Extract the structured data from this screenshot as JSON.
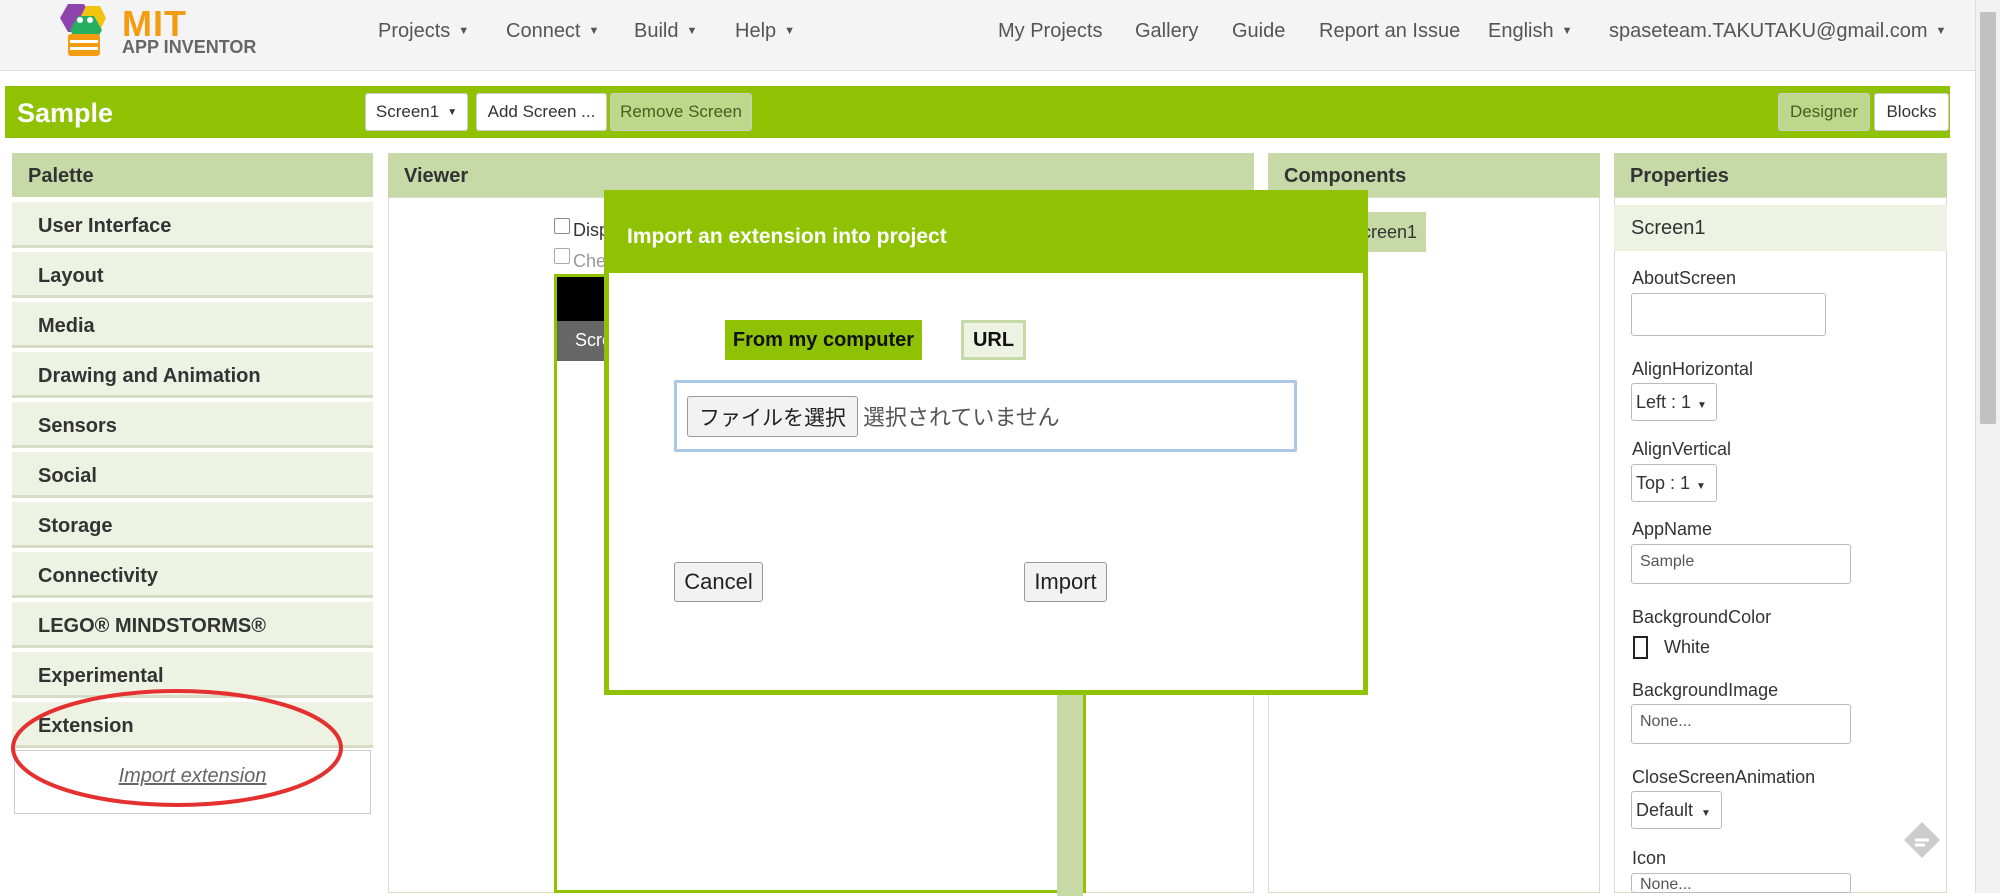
{
  "nav": {
    "logo_title": "MIT",
    "logo_subtitle": "APP INVENTOR",
    "projects": "Projects",
    "connect": "Connect",
    "build": "Build",
    "help": "Help",
    "my_projects": "My Projects",
    "gallery": "Gallery",
    "guide": "Guide",
    "report": "Report an Issue",
    "language": "English",
    "account": "spaseteam.TAKUTAKU@gmail.com"
  },
  "projectbar": {
    "title": "Sample",
    "screen_select": "Screen1",
    "add_screen": "Add Screen ...",
    "remove_screen": "Remove Screen",
    "designer": "Designer",
    "blocks": "Blocks"
  },
  "palette": {
    "header": "Palette",
    "items": [
      "User Interface",
      "Layout",
      "Media",
      "Drawing and Animation",
      "Sensors",
      "Social",
      "Storage",
      "Connectivity",
      "LEGO® MINDSTORMS®",
      "Experimental",
      "Extension"
    ],
    "import_link": "Import extension"
  },
  "viewer": {
    "header": "Viewer",
    "check1": "Disp",
    "check2": "Che",
    "screen_tab": "Scre"
  },
  "components": {
    "header": "Components",
    "item": "creen1"
  },
  "properties": {
    "header": "Properties",
    "component": "Screen1",
    "about_screen": "AboutScreen",
    "align_h": "AlignHorizontal",
    "align_h_value": "Left : 1",
    "align_v": "AlignVertical",
    "align_v_value": "Top : 1",
    "app_name": "AppName",
    "app_name_value": "Sample",
    "bg_color": "BackgroundColor",
    "bg_color_value": "White",
    "bg_image": "BackgroundImage",
    "bg_image_value": "None...",
    "close_anim": "CloseScreenAnimation",
    "close_anim_value": "Default",
    "icon": "Icon",
    "icon_value": "None..."
  },
  "dialog": {
    "title": "Import an extension into project",
    "tab_computer": "From my computer",
    "tab_url": "URL",
    "file_button": "ファイルを選択",
    "file_status": "選択されていません",
    "cancel": "Cancel",
    "import": "Import"
  },
  "colors": {
    "accent": "#8fc202",
    "panel_header": "#c8d9a8",
    "highlight": "#e53030"
  }
}
